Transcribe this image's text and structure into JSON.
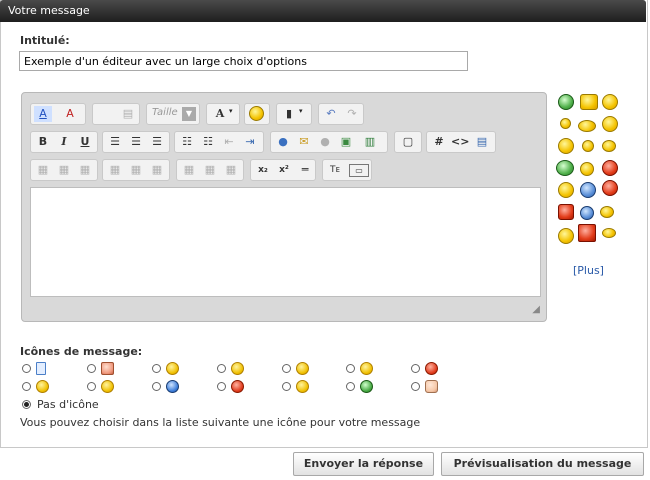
{
  "panel": {
    "title": "Votre message"
  },
  "subject": {
    "label": "Intitulé:",
    "value": "Exemple d'un éditeur avec un large choix d'options"
  },
  "toolbar": {
    "font_name": "Taille",
    "bold": "B",
    "italic": "I",
    "underline": "U",
    "font_size": "A",
    "hash": "#",
    "code": "<>",
    "subscript": "x₂",
    "superscript": "x²",
    "plain": "Tᴇ"
  },
  "smilies": {
    "more_label": "[Plus]"
  },
  "post_icons": {
    "label": "Icônes de message:",
    "no_icon_label": "Pas d'icône",
    "help_text": "Vous pouvez choisir dans la liste suivante une icône pour votre message"
  },
  "buttons": {
    "submit": "Envoyer la réponse",
    "preview": "Prévisualisation du message"
  }
}
